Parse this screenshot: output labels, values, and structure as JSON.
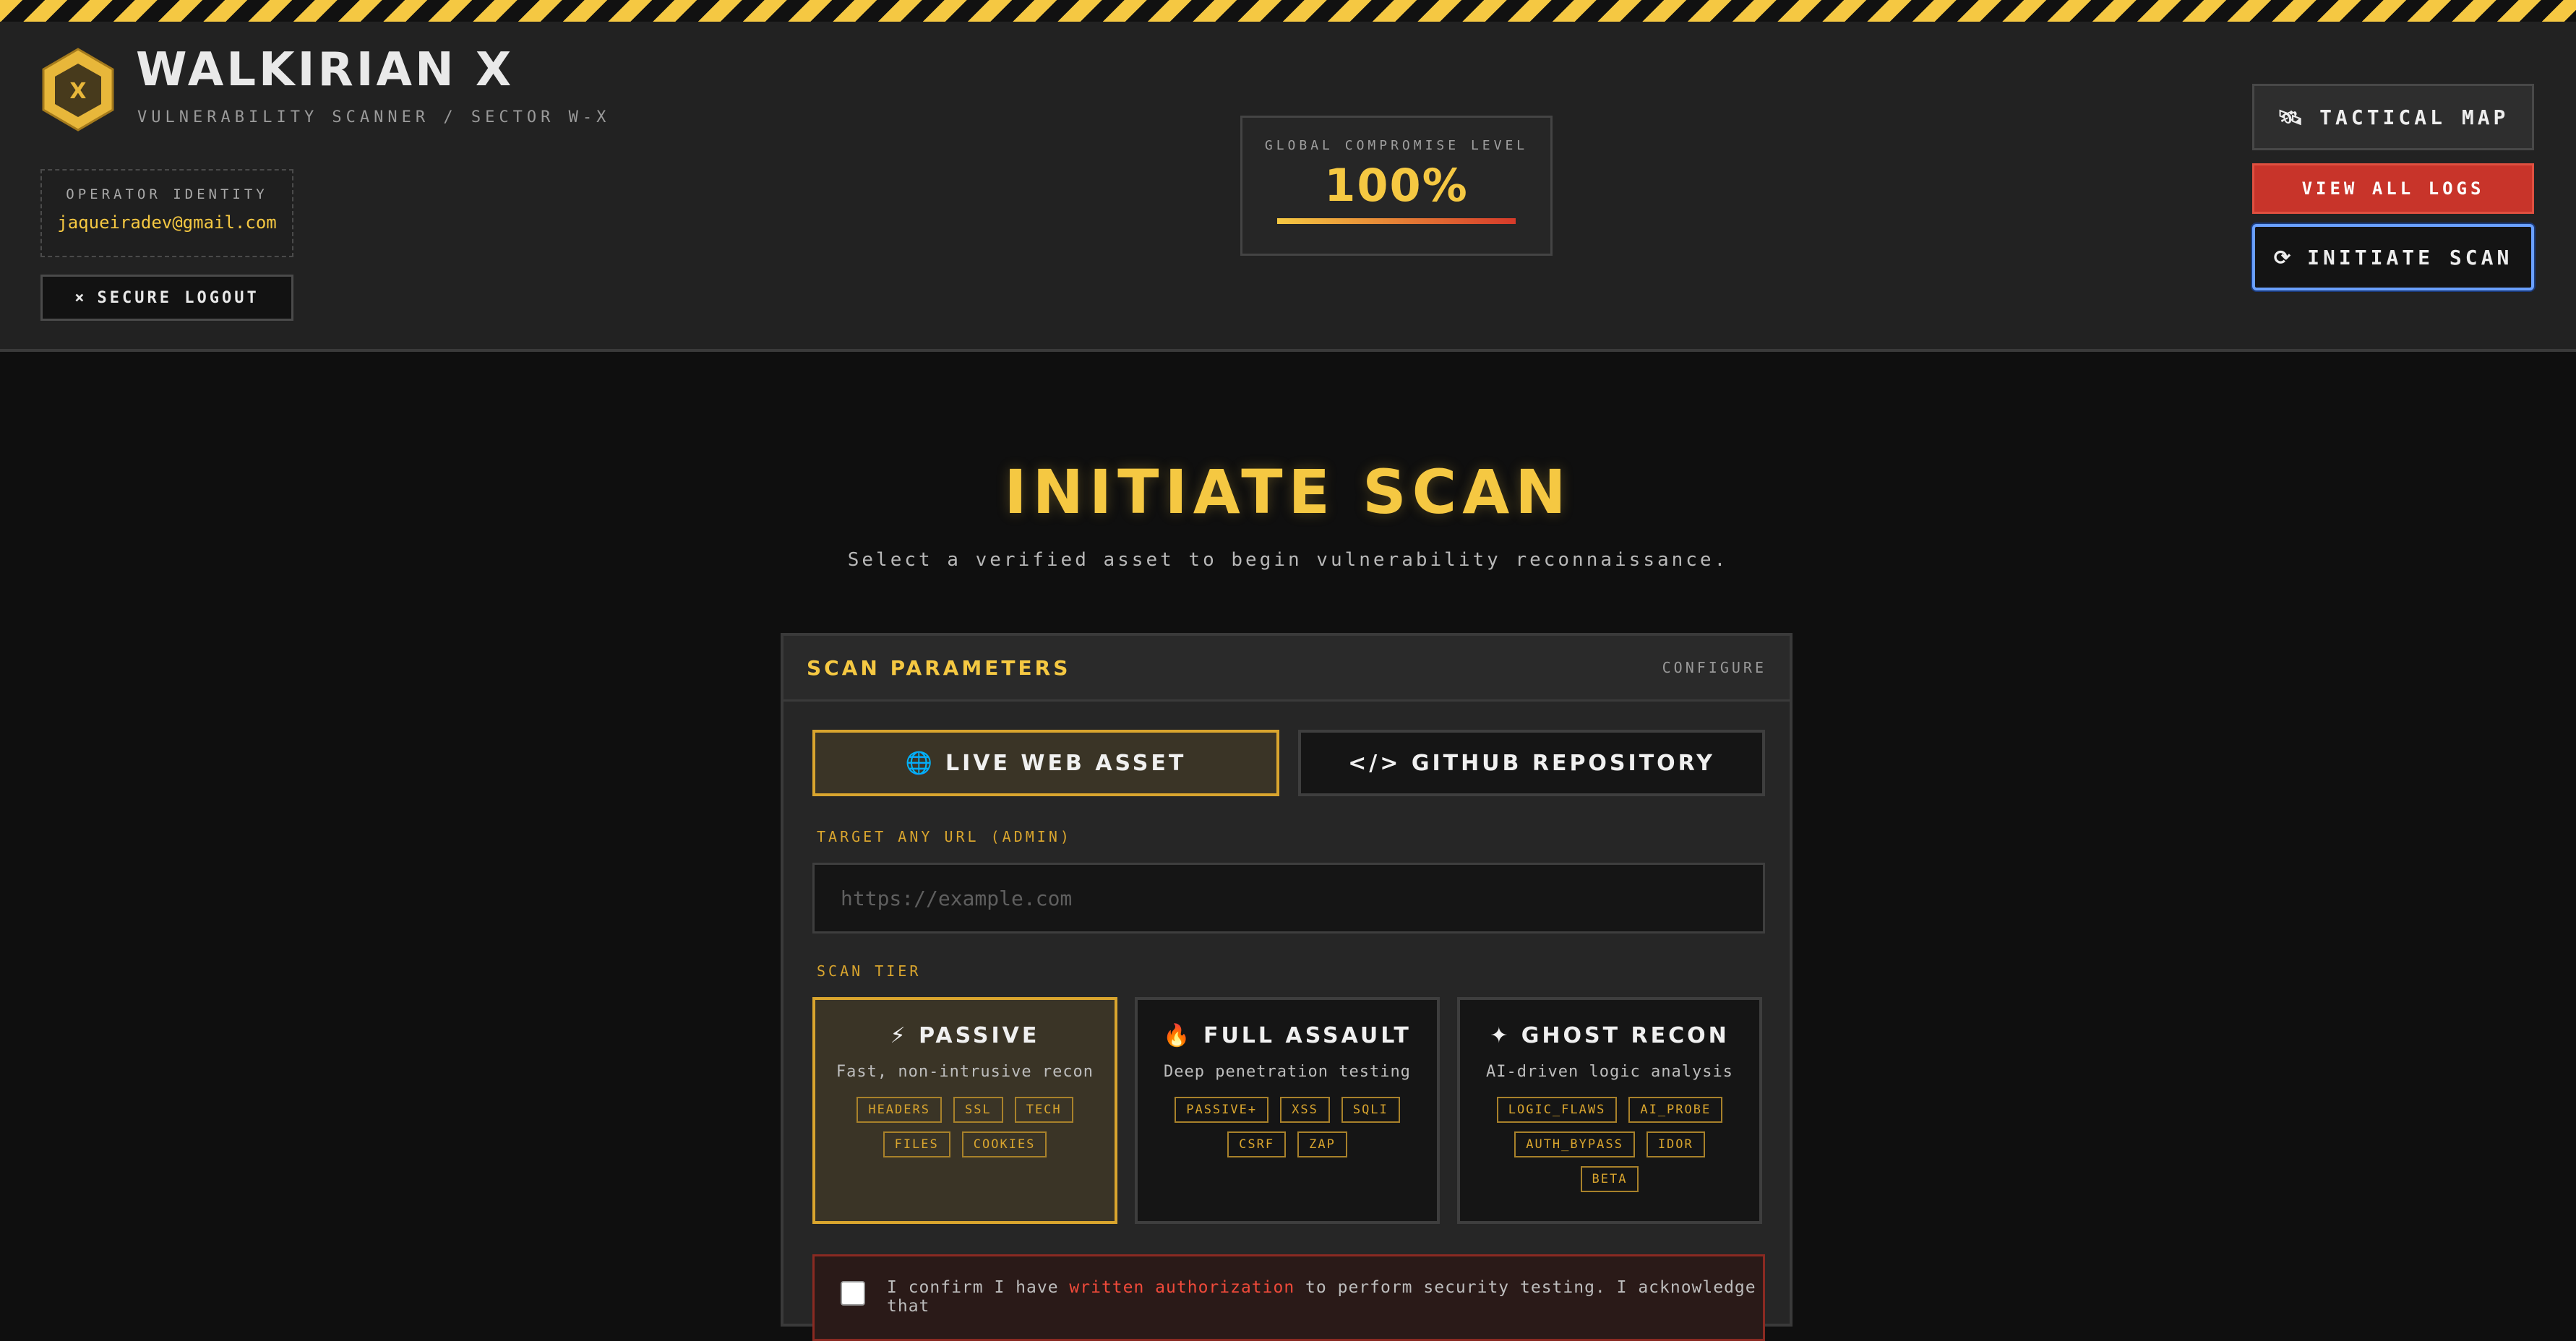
{
  "header": {
    "brand_title": "WALKIRIAN X",
    "brand_subtitle": "VULNERABILITY SCANNER / SECTOR W-X",
    "operator_label": "OPERATOR IDENTITY",
    "operator_email": "jaqueiradev@gmail.com",
    "logout_icon": "×",
    "logout_label": "SECURE LOGOUT",
    "compromise_label": "GLOBAL COMPROMISE LEVEL",
    "compromise_value": "100%",
    "compromise_level": 1.0,
    "tactical_map_label": "TACTICAL MAP",
    "tactical_map_icon": "🛰",
    "view_logs_label": "VIEW ALL LOGS",
    "initiate_scan_icon": "⟳",
    "initiate_scan_label": "INITIATE SCAN"
  },
  "main": {
    "title": "INITIATE SCAN",
    "subtitle": "Select a verified asset to begin vulnerability reconnaissance.",
    "panel": {
      "title": "SCAN PARAMETERS",
      "configure_label": "CONFIGURE",
      "tab_web_icon": "🌐",
      "tab_web_label": "LIVE WEB ASSET",
      "tab_git_label": "</> GITHUB REPOSITORY",
      "url_label": "TARGET ANY URL (ADMIN)",
      "url_placeholder": "https://example.com",
      "url_value": "",
      "tier_label": "SCAN TIER",
      "tiers": [
        {
          "icon": "⚡",
          "name": "PASSIVE",
          "description": "Fast, non-intrusive recon",
          "tags": [
            "HEADERS",
            "SSL",
            "TECH",
            "FILES",
            "COOKIES"
          ],
          "selected": true
        },
        {
          "icon": "🔥",
          "name": "FULL ASSAULT",
          "description": "Deep penetration testing",
          "tags": [
            "PASSIVE+",
            "XSS",
            "SQLI",
            "CSRF",
            "ZAP"
          ],
          "selected": false
        },
        {
          "icon": "✦",
          "name": "GHOST RECON",
          "description": "AI-driven logic analysis",
          "tags": [
            "LOGIC_FLAWS",
            "AI_PROBE",
            "AUTH_BYPASS",
            "IDOR",
            "BETA"
          ],
          "selected": false
        }
      ],
      "confirm_prefix": "I confirm I have ",
      "confirm_link": "written authorization",
      "confirm_suffix": " to perform security testing. I acknowledge that"
    }
  },
  "colors": {
    "accent": "#f5c842",
    "danger": "#c8342a",
    "focus": "#6aa0ff"
  }
}
